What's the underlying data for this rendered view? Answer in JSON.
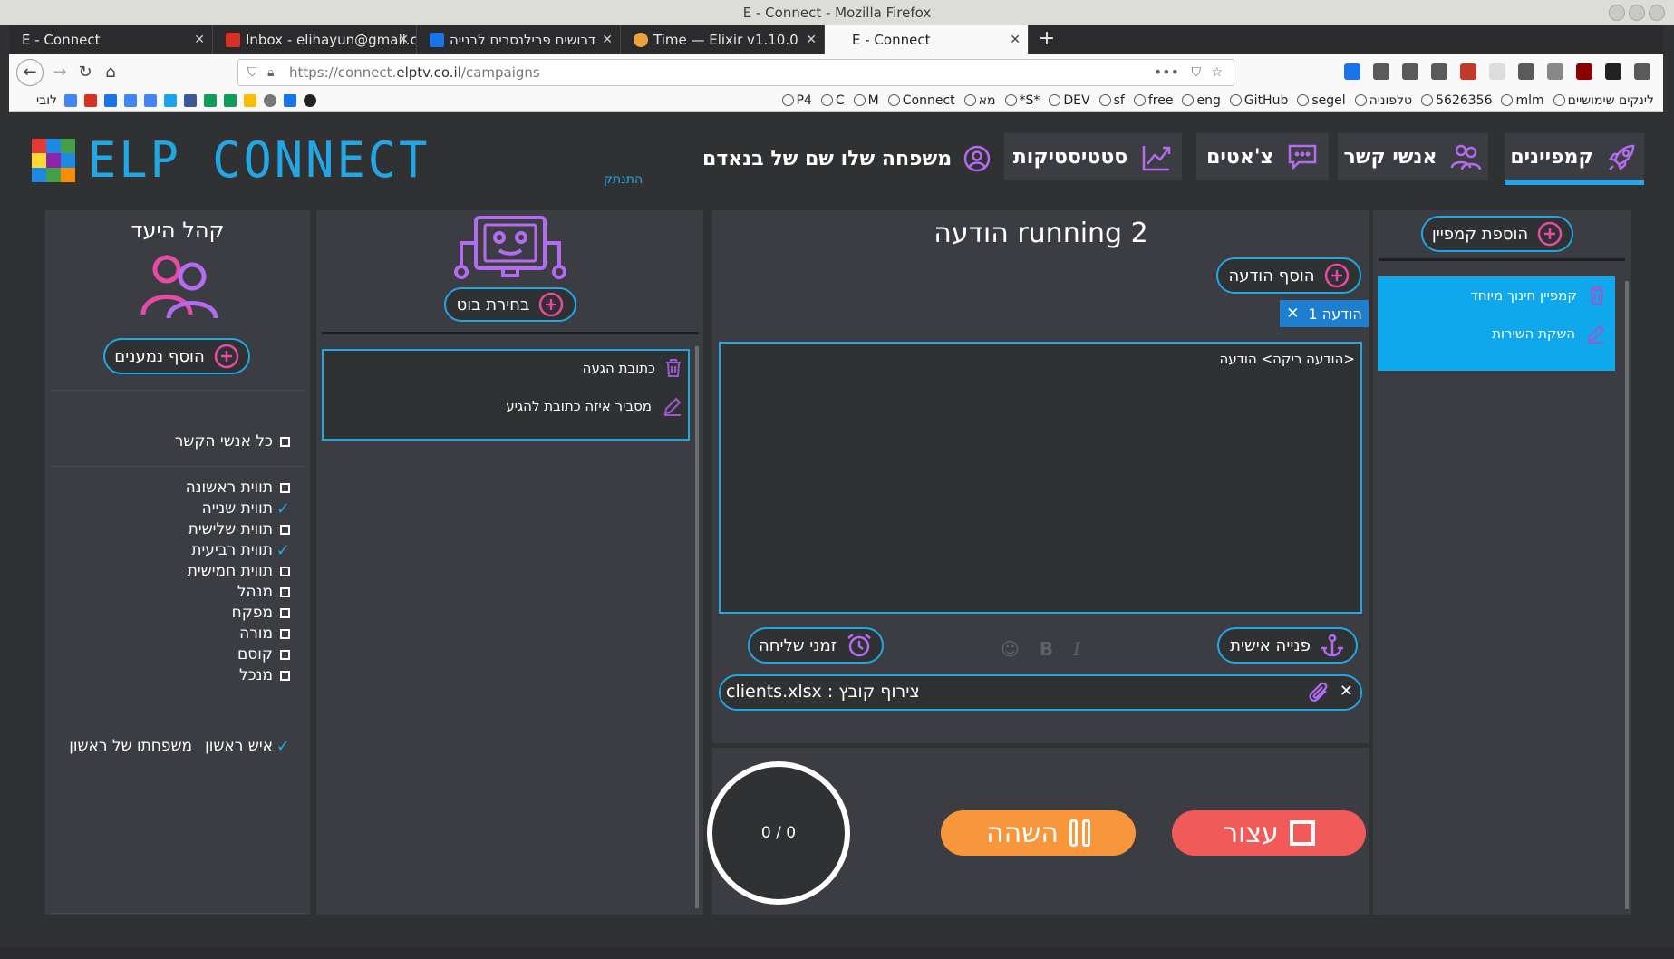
{
  "window": {
    "title": "E - Connect - Mozilla Firefox"
  },
  "tabs": [
    {
      "label": "E - Connect",
      "color": "#2b2b2e"
    },
    {
      "label": "Inbox - elihayun@gmail.c",
      "color": "#d93025"
    },
    {
      "label": "דרושים פרילנסרים לבנייה",
      "color": "#1a73e8"
    },
    {
      "label": "Time — Elixir v1.10.0",
      "color": "#6e4a7e"
    },
    {
      "label": "E - Connect",
      "color": "#f9f9fa"
    }
  ],
  "url": {
    "prefix": "https://connect.",
    "domain": "elptv.co.il",
    "path": "/campaigns"
  },
  "bookmarks": {
    "right": [
      "לינקים שימושיים",
      "mlm",
      "5626356",
      "טלפוניה",
      "segel",
      "GitHub",
      "eng",
      "free",
      "sf",
      "DEV",
      "*S*",
      "מא",
      "Connect",
      "M",
      "C",
      "P4"
    ],
    "left_label": "לובי"
  },
  "app": {
    "logo_text": "ELP CONNECT",
    "nav": {
      "campaigns": "קמפיינים",
      "contacts": "אנשי קשר",
      "chats": "צ'אטים",
      "stats": "סטטיסטיקות"
    },
    "user_name": "משפחה שלו שם של בנאדם",
    "logout": "התנתק"
  },
  "campaigns_panel": {
    "add_button": "הוספת קמפיין",
    "items": [
      {
        "name": "קמפיין חינוך מיוחד"
      },
      {
        "name": "השקת השירות"
      }
    ]
  },
  "message_panel": {
    "title": "הודעה running 2",
    "add_message": "הוסף הודעה",
    "message_chip": "הודעה 1",
    "editor_text": "<הודעה ריקה> הודעה",
    "personal_address": "פנייה אישית",
    "send_times": "זמני שליחה",
    "attachment": "צירוף קובץ : clients.xlsx"
  },
  "controls": {
    "stop": "עצור",
    "pause": "השהה",
    "progress_text": "0 / 0"
  },
  "bot_panel": {
    "choose_bot": "בחירת בוט",
    "items": [
      {
        "text": "כתובת הגעה"
      },
      {
        "text": "מסביר איזה כתובת להגיע"
      }
    ]
  },
  "audience_panel": {
    "title": "קהל היעד",
    "add_recipients": "הוסף נמענים",
    "all_contacts": {
      "label": "כל אנשי הקשר",
      "checked": false
    },
    "tags": [
      {
        "label": "תווית ראשונה",
        "checked": false
      },
      {
        "label": "תווית שנייה",
        "checked": true
      },
      {
        "label": "תווית שלישית",
        "checked": false
      },
      {
        "label": "תווית רביעית",
        "checked": true
      },
      {
        "label": "תווית חמישית",
        "checked": false
      },
      {
        "label": "מנהל",
        "checked": false
      },
      {
        "label": "מפקח",
        "checked": false
      },
      {
        "label": "מורה",
        "checked": false
      },
      {
        "label": "קוסם",
        "checked": false
      },
      {
        "label": "מנכל",
        "checked": false
      }
    ],
    "person": {
      "first": "איש ראשון",
      "last": "משפחתו של ראשון",
      "checked": true
    }
  },
  "colors": {
    "accent_blue": "#22a7e6",
    "icon_purple": "#b46bf0",
    "stop_red": "#f25a5a",
    "pause_orange": "#f7963a"
  }
}
